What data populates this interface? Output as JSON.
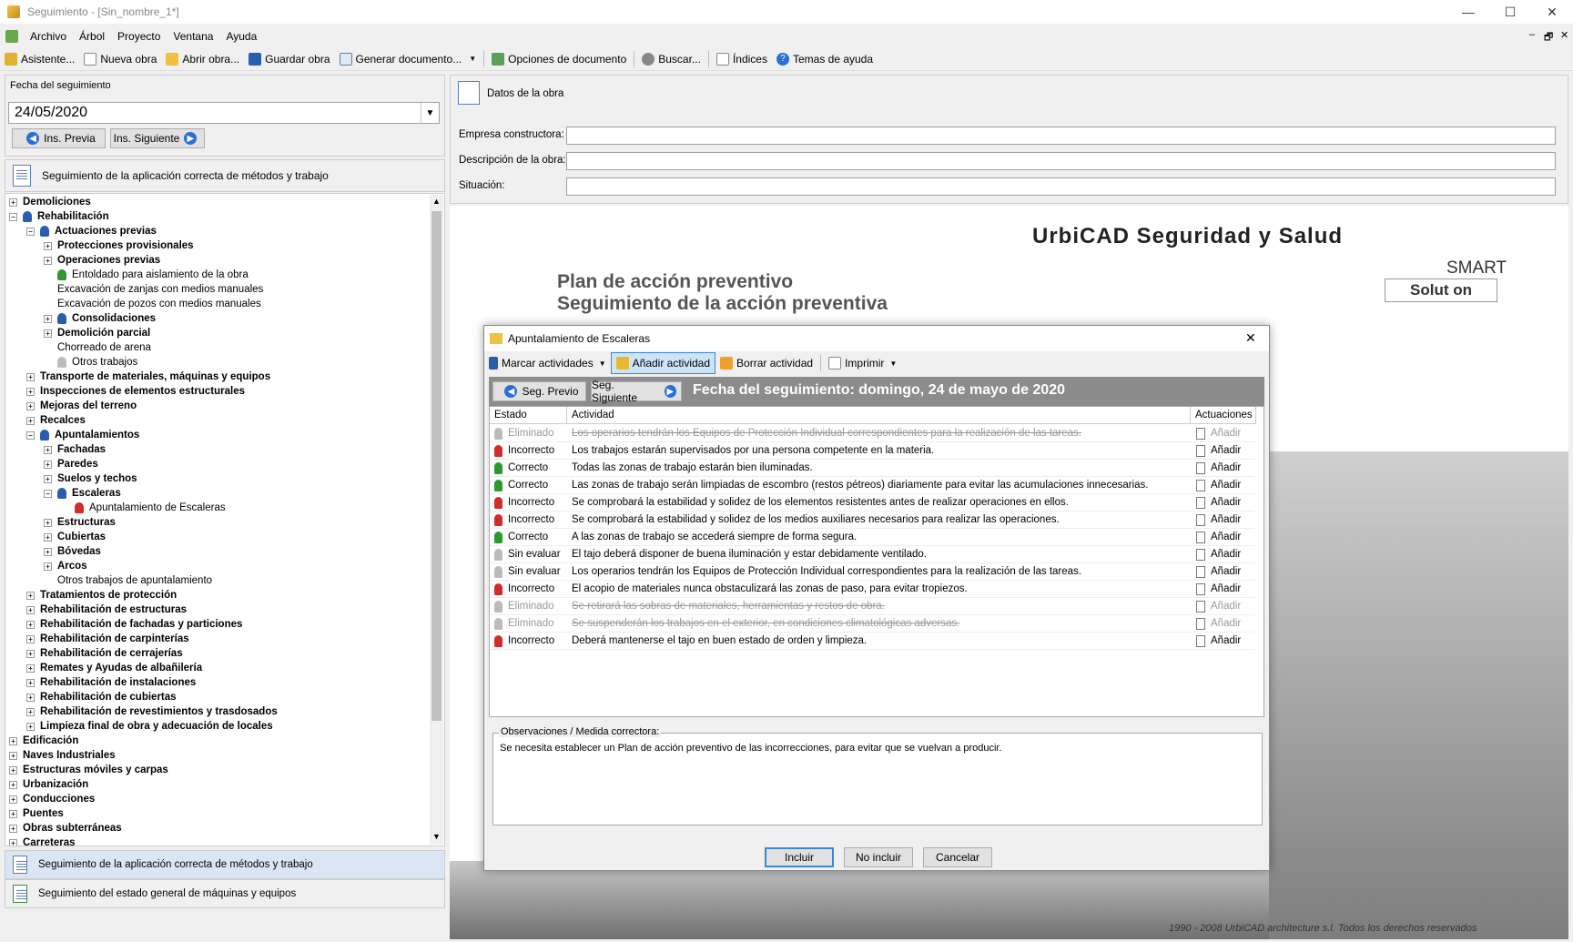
{
  "window": {
    "title": "Seguimiento - [Sin_nombre_1*]",
    "minimize": "—",
    "maximize": "☐",
    "close": "✕"
  },
  "menu": [
    "Archivo",
    "Árbol",
    "Proyecto",
    "Ventana",
    "Ayuda"
  ],
  "mdi": {
    "min": "–",
    "restore": "🗗",
    "close": "✕"
  },
  "toolbar": [
    "Asistente...",
    "Nueva obra",
    "Abrir obra...",
    "Guardar obra",
    "Generar documento...",
    "Opciones de documento",
    "Buscar...",
    "Índices",
    "Temas de ayuda"
  ],
  "left": {
    "date_label": "Fecha del seguimiento",
    "date_value": "24/05/2020",
    "prev_btn": "Ins. Previa",
    "next_btn": "Ins. Siguiente",
    "tree_header": "Seguimiento de la aplicación correcta de métodos y trabajo",
    "tree": [
      {
        "t": "Demoliciones",
        "lv": 0,
        "pm": "+",
        "b": true
      },
      {
        "t": "Rehabilitación",
        "lv": 0,
        "pm": "−",
        "b": true,
        "ic": "#2a5db0"
      },
      {
        "t": "Actuaciones previas",
        "lv": 1,
        "pm": "−",
        "b": true,
        "ic": "#2a5db0"
      },
      {
        "t": "Protecciones provisionales",
        "lv": 2,
        "pm": "+",
        "b": true
      },
      {
        "t": "Operaciones previas",
        "lv": 2,
        "pm": "+",
        "b": true
      },
      {
        "t": "Entoldado para aislamiento de la obra",
        "lv": 2,
        "ic": "#2e9a2e"
      },
      {
        "t": "Excavación de zanjas con medios manuales",
        "lv": 2
      },
      {
        "t": "Excavación de pozos con medios manuales",
        "lv": 2
      },
      {
        "t": "Consolidaciones",
        "lv": 2,
        "pm": "+",
        "b": true,
        "ic": "#2a5db0"
      },
      {
        "t": "Demolición parcial",
        "lv": 2,
        "pm": "+",
        "b": true
      },
      {
        "t": "Chorreado de arena",
        "lv": 2
      },
      {
        "t": "Otros trabajos",
        "lv": 2,
        "ic": "#bbbbbb"
      },
      {
        "t": "Transporte de materiales, máquinas y equipos",
        "lv": 1,
        "pm": "+",
        "b": true
      },
      {
        "t": "Inspecciones de elementos estructurales",
        "lv": 1,
        "pm": "+",
        "b": true
      },
      {
        "t": "Mejoras del terreno",
        "lv": 1,
        "pm": "+",
        "b": true
      },
      {
        "t": "Recalces",
        "lv": 1,
        "pm": "+",
        "b": true
      },
      {
        "t": "Apuntalamientos",
        "lv": 1,
        "pm": "−",
        "b": true,
        "ic": "#2a5db0"
      },
      {
        "t": "Fachadas",
        "lv": 2,
        "pm": "+",
        "b": true
      },
      {
        "t": "Paredes",
        "lv": 2,
        "pm": "+",
        "b": true
      },
      {
        "t": "Suelos y techos",
        "lv": 2,
        "pm": "+",
        "b": true
      },
      {
        "t": "Escaleras",
        "lv": 2,
        "pm": "−",
        "b": true,
        "ic": "#2a5db0"
      },
      {
        "t": "Apuntalamiento de Escaleras",
        "lv": 3,
        "ic": "#d12b2b"
      },
      {
        "t": "Estructuras",
        "lv": 2,
        "pm": "+",
        "b": true
      },
      {
        "t": "Cubiertas",
        "lv": 2,
        "pm": "+",
        "b": true
      },
      {
        "t": "Bóvedas",
        "lv": 2,
        "pm": "+",
        "b": true
      },
      {
        "t": "Arcos",
        "lv": 2,
        "pm": "+",
        "b": true
      },
      {
        "t": "Otros trabajos de apuntalamiento",
        "lv": 2
      },
      {
        "t": "Tratamientos de protección",
        "lv": 1,
        "pm": "+",
        "b": true
      },
      {
        "t": "Rehabilitación de estructuras",
        "lv": 1,
        "pm": "+",
        "b": true
      },
      {
        "t": "Rehabilitación de fachadas y particiones",
        "lv": 1,
        "pm": "+",
        "b": true
      },
      {
        "t": "Rehabilitación de carpinterías",
        "lv": 1,
        "pm": "+",
        "b": true
      },
      {
        "t": "Rehabilitación de cerrajerías",
        "lv": 1,
        "pm": "+",
        "b": true
      },
      {
        "t": "Remates y Ayudas de albañilería",
        "lv": 1,
        "pm": "+",
        "b": true
      },
      {
        "t": "Rehabilitación de instalaciones",
        "lv": 1,
        "pm": "+",
        "b": true
      },
      {
        "t": "Rehabilitación de cubiertas",
        "lv": 1,
        "pm": "+",
        "b": true
      },
      {
        "t": "Rehabilitación de revestimientos y trasdosados",
        "lv": 1,
        "pm": "+",
        "b": true
      },
      {
        "t": "Limpieza final de obra y adecuación de locales",
        "lv": 1,
        "pm": "+",
        "b": true
      },
      {
        "t": "Edificación",
        "lv": 0,
        "pm": "+",
        "b": true
      },
      {
        "t": "Naves Industriales",
        "lv": 0,
        "pm": "+",
        "b": true
      },
      {
        "t": "Estructuras móviles y carpas",
        "lv": 0,
        "pm": "+",
        "b": true
      },
      {
        "t": "Urbanización",
        "lv": 0,
        "pm": "+",
        "b": true
      },
      {
        "t": "Conducciones",
        "lv": 0,
        "pm": "+",
        "b": true
      },
      {
        "t": "Puentes",
        "lv": 0,
        "pm": "+",
        "b": true
      },
      {
        "t": "Obras subterráneas",
        "lv": 0,
        "pm": "+",
        "b": true
      },
      {
        "t": "Carreteras",
        "lv": 0,
        "pm": "+",
        "b": true
      }
    ],
    "bottom_items": [
      "Seguimiento de la aplicación correcta de métodos y trabajo",
      "Seguimiento del estado general de máquinas y equipos"
    ]
  },
  "datos": {
    "title": "Datos de la obra",
    "fields": [
      {
        "label": "Empresa constructora:",
        "value": ""
      },
      {
        "label": "Descripción de la obra:",
        "value": ""
      },
      {
        "label": "Situación:",
        "value": ""
      }
    ]
  },
  "bg": {
    "brand": "UrbiCAD Seguridad y Salud",
    "smart": "SMART",
    "solution": "Solut on",
    "line1": "Plan de acción preventivo",
    "line2": "Seguimiento de la acción preventiva",
    "copyright": "1990 - 2008 UrbiCAD architecture s.l. Todos los derechos reservados"
  },
  "dialog": {
    "title": "Apuntalamiento de Escaleras",
    "close": "✕",
    "toolbar": [
      "Marcar actividades",
      "Añadir actividad",
      "Borrar actividad",
      "Imprimir"
    ],
    "prev_btn": "Seg. Previo",
    "next_btn": "Seg. Siguiente",
    "date_title": "Fecha del seguimiento:  domingo, 24 de mayo de 2020",
    "headers": [
      "Estado",
      "Actividad",
      "Actuaciones"
    ],
    "rows": [
      {
        "estado": "Eliminado",
        "actividad": "Los operarios tendrán los Equipos de Protección Individual correspondientes para la realización de las tareas.",
        "act": "Añadir",
        "c": "#bbbbbb",
        "del": true
      },
      {
        "estado": "Incorrecto",
        "actividad": "Los trabajos estarán supervisados por una persona competente en la materia.",
        "act": "Añadir",
        "c": "#d12b2b"
      },
      {
        "estado": "Correcto",
        "actividad": "Todas las zonas de trabajo estarán bien iluminadas.",
        "act": "Añadir",
        "c": "#2e9a2e"
      },
      {
        "estado": "Correcto",
        "actividad": "Las zonas de trabajo serán limpiadas de escombro (restos pétreos) diariamente para evitar las acumulaciones innecesarias.",
        "act": "Añadir",
        "c": "#2e9a2e"
      },
      {
        "estado": "Incorrecto",
        "actividad": "Se comprobará la estabilidad y solidez de los elementos resistentes antes de realizar operaciones en ellos.",
        "act": "Añadir",
        "c": "#d12b2b"
      },
      {
        "estado": "Incorrecto",
        "actividad": "Se comprobará la estabilidad y solidez de los medios auxiliares necesarios para realizar las operaciones.",
        "act": "Añadir",
        "c": "#d12b2b"
      },
      {
        "estado": "Correcto",
        "actividad": "A las zonas de trabajo se accederá siempre de forma segura.",
        "act": "Añadir",
        "c": "#2e9a2e"
      },
      {
        "estado": "Sin evaluar",
        "actividad": "El tajo deberá disponer de buena iluminación y estar debidamente ventilado.",
        "act": "Añadir",
        "c": "#bbbbbb"
      },
      {
        "estado": "Sin evaluar",
        "actividad": "Los operarios tendrán los Equipos de Protección Individual correspondientes para la realización de las tareas.",
        "act": "Añadir",
        "c": "#bbbbbb"
      },
      {
        "estado": "Incorrecto",
        "actividad": "El acopio de materiales nunca obstaculizará las zonas de paso, para evitar tropiezos.",
        "act": "Añadir",
        "c": "#d12b2b"
      },
      {
        "estado": "Eliminado",
        "actividad": "Se retirará las sobras de materiales, herramientas y restos de obra.",
        "act": "Añadir",
        "c": "#bbbbbb",
        "del": true
      },
      {
        "estado": "Eliminado",
        "actividad": "Se suspenderán los trabajos en el exterior, en condiciones climatológicas adversas.",
        "act": "Añadir",
        "c": "#bbbbbb",
        "del": true
      },
      {
        "estado": "Incorrecto",
        "actividad": "Deberá mantenerse el tajo en buen estado de orden y limpieza.",
        "act": "Añadir",
        "c": "#d12b2b"
      }
    ],
    "obs_label": "Observaciones / Medida correctora:",
    "obs_text": "Se necesita establecer un Plan de acción preventivo de las incorrecciones, para evitar que se vuelvan a producir.",
    "buttons": [
      "Incluir",
      "No incluir",
      "Cancelar"
    ]
  }
}
